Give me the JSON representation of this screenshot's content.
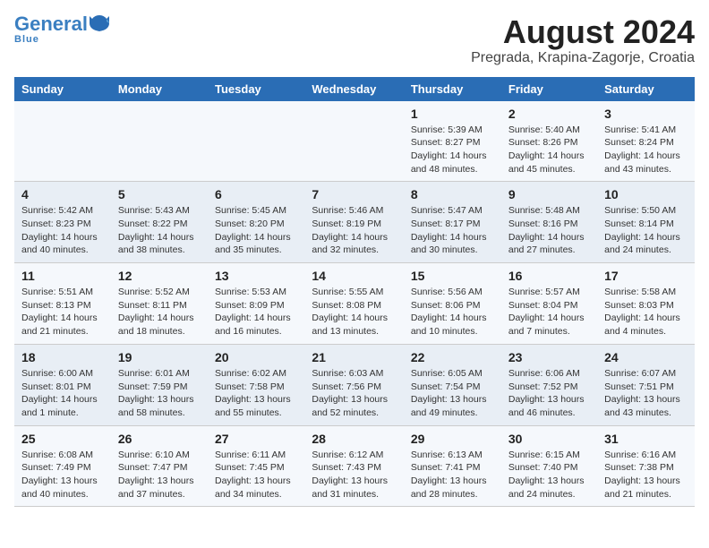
{
  "header": {
    "logo_general": "General",
    "logo_blue": "Blue",
    "month_title": "August 2024",
    "location": "Pregrada, Krapina-Zagorje, Croatia"
  },
  "weekdays": [
    "Sunday",
    "Monday",
    "Tuesday",
    "Wednesday",
    "Thursday",
    "Friday",
    "Saturday"
  ],
  "weeks": [
    [
      {
        "day": "",
        "info": ""
      },
      {
        "day": "",
        "info": ""
      },
      {
        "day": "",
        "info": ""
      },
      {
        "day": "",
        "info": ""
      },
      {
        "day": "1",
        "info": "Sunrise: 5:39 AM\nSunset: 8:27 PM\nDaylight: 14 hours\nand 48 minutes."
      },
      {
        "day": "2",
        "info": "Sunrise: 5:40 AM\nSunset: 8:26 PM\nDaylight: 14 hours\nand 45 minutes."
      },
      {
        "day": "3",
        "info": "Sunrise: 5:41 AM\nSunset: 8:24 PM\nDaylight: 14 hours\nand 43 minutes."
      }
    ],
    [
      {
        "day": "4",
        "info": "Sunrise: 5:42 AM\nSunset: 8:23 PM\nDaylight: 14 hours\nand 40 minutes."
      },
      {
        "day": "5",
        "info": "Sunrise: 5:43 AM\nSunset: 8:22 PM\nDaylight: 14 hours\nand 38 minutes."
      },
      {
        "day": "6",
        "info": "Sunrise: 5:45 AM\nSunset: 8:20 PM\nDaylight: 14 hours\nand 35 minutes."
      },
      {
        "day": "7",
        "info": "Sunrise: 5:46 AM\nSunset: 8:19 PM\nDaylight: 14 hours\nand 32 minutes."
      },
      {
        "day": "8",
        "info": "Sunrise: 5:47 AM\nSunset: 8:17 PM\nDaylight: 14 hours\nand 30 minutes."
      },
      {
        "day": "9",
        "info": "Sunrise: 5:48 AM\nSunset: 8:16 PM\nDaylight: 14 hours\nand 27 minutes."
      },
      {
        "day": "10",
        "info": "Sunrise: 5:50 AM\nSunset: 8:14 PM\nDaylight: 14 hours\nand 24 minutes."
      }
    ],
    [
      {
        "day": "11",
        "info": "Sunrise: 5:51 AM\nSunset: 8:13 PM\nDaylight: 14 hours\nand 21 minutes."
      },
      {
        "day": "12",
        "info": "Sunrise: 5:52 AM\nSunset: 8:11 PM\nDaylight: 14 hours\nand 18 minutes."
      },
      {
        "day": "13",
        "info": "Sunrise: 5:53 AM\nSunset: 8:09 PM\nDaylight: 14 hours\nand 16 minutes."
      },
      {
        "day": "14",
        "info": "Sunrise: 5:55 AM\nSunset: 8:08 PM\nDaylight: 14 hours\nand 13 minutes."
      },
      {
        "day": "15",
        "info": "Sunrise: 5:56 AM\nSunset: 8:06 PM\nDaylight: 14 hours\nand 10 minutes."
      },
      {
        "day": "16",
        "info": "Sunrise: 5:57 AM\nSunset: 8:04 PM\nDaylight: 14 hours\nand 7 minutes."
      },
      {
        "day": "17",
        "info": "Sunrise: 5:58 AM\nSunset: 8:03 PM\nDaylight: 14 hours\nand 4 minutes."
      }
    ],
    [
      {
        "day": "18",
        "info": "Sunrise: 6:00 AM\nSunset: 8:01 PM\nDaylight: 14 hours\nand 1 minute."
      },
      {
        "day": "19",
        "info": "Sunrise: 6:01 AM\nSunset: 7:59 PM\nDaylight: 13 hours\nand 58 minutes."
      },
      {
        "day": "20",
        "info": "Sunrise: 6:02 AM\nSunset: 7:58 PM\nDaylight: 13 hours\nand 55 minutes."
      },
      {
        "day": "21",
        "info": "Sunrise: 6:03 AM\nSunset: 7:56 PM\nDaylight: 13 hours\nand 52 minutes."
      },
      {
        "day": "22",
        "info": "Sunrise: 6:05 AM\nSunset: 7:54 PM\nDaylight: 13 hours\nand 49 minutes."
      },
      {
        "day": "23",
        "info": "Sunrise: 6:06 AM\nSunset: 7:52 PM\nDaylight: 13 hours\nand 46 minutes."
      },
      {
        "day": "24",
        "info": "Sunrise: 6:07 AM\nSunset: 7:51 PM\nDaylight: 13 hours\nand 43 minutes."
      }
    ],
    [
      {
        "day": "25",
        "info": "Sunrise: 6:08 AM\nSunset: 7:49 PM\nDaylight: 13 hours\nand 40 minutes."
      },
      {
        "day": "26",
        "info": "Sunrise: 6:10 AM\nSunset: 7:47 PM\nDaylight: 13 hours\nand 37 minutes."
      },
      {
        "day": "27",
        "info": "Sunrise: 6:11 AM\nSunset: 7:45 PM\nDaylight: 13 hours\nand 34 minutes."
      },
      {
        "day": "28",
        "info": "Sunrise: 6:12 AM\nSunset: 7:43 PM\nDaylight: 13 hours\nand 31 minutes."
      },
      {
        "day": "29",
        "info": "Sunrise: 6:13 AM\nSunset: 7:41 PM\nDaylight: 13 hours\nand 28 minutes."
      },
      {
        "day": "30",
        "info": "Sunrise: 6:15 AM\nSunset: 7:40 PM\nDaylight: 13 hours\nand 24 minutes."
      },
      {
        "day": "31",
        "info": "Sunrise: 6:16 AM\nSunset: 7:38 PM\nDaylight: 13 hours\nand 21 minutes."
      }
    ]
  ]
}
